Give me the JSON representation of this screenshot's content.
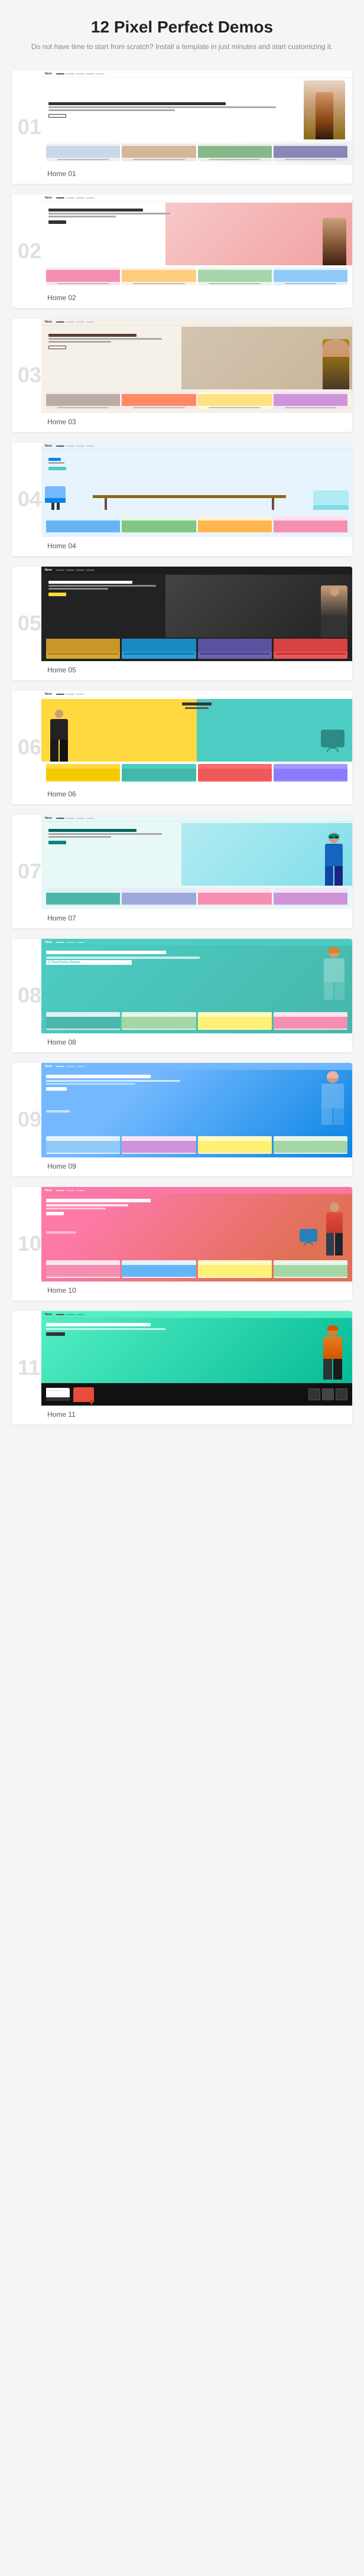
{
  "page": {
    "title": "12 Pixel Perfect Demos",
    "subtitle": "Do not have time to start from scratch? Install a template\nin just minutes and start customizing it."
  },
  "demos": [
    {
      "id": "01",
      "label": "Home 01",
      "theme": "white",
      "accent": "#333333"
    },
    {
      "id": "02",
      "label": "Home 02",
      "theme": "pink",
      "accent": "#f8c8c8"
    },
    {
      "id": "03",
      "label": "Home 03",
      "theme": "beige",
      "accent": "#f5f0e8"
    },
    {
      "id": "04",
      "label": "Home 04",
      "theme": "furniture",
      "accent": "#74b9ff"
    },
    {
      "id": "05",
      "label": "Home 05",
      "theme": "dark",
      "accent": "#333333"
    },
    {
      "id": "06",
      "label": "Home 06",
      "theme": "yellow-teal",
      "accent": "#ffd93d"
    },
    {
      "id": "07",
      "label": "Home 07",
      "theme": "teal-light",
      "accent": "#4ecdc4"
    },
    {
      "id": "08",
      "label": "Home 08",
      "theme": "teal",
      "accent": "#4ecdc4"
    },
    {
      "id": "09",
      "label": "Home 09",
      "theme": "blue",
      "accent": "#74b9ff"
    },
    {
      "id": "10",
      "label": "Home 10",
      "theme": "pink-coral",
      "accent": "#fd79a8"
    },
    {
      "id": "11",
      "label": "Home 11",
      "theme": "mint",
      "accent": "#55efc4"
    }
  ],
  "hero_texts": {
    "h01": {
      "title": "Summer Clothing Holiday",
      "sub": "Shop the latest trends",
      "btn": "Shop Now"
    },
    "h02": {
      "title": "Summer Clothing Holiday",
      "sub": "New arrivals every week",
      "btn": "Shop Now"
    },
    "h03": {
      "title": "Summer Clothing Holiday",
      "sub": "Discover your style",
      "btn": "Shop Now"
    },
    "h04": {
      "title": "Summer Clean",
      "sub": "Modern furniture collection",
      "btn": "Shop Now"
    },
    "h05": {
      "title": "Summer Clothing Holiday",
      "sub": "Trendy items await",
      "btn": "Shop Now"
    },
    "h06": {
      "title": "Summer Clothing Holiday",
      "sub": "Bold styles bold colors",
      "btn": "Shop Now"
    },
    "h07": {
      "title": "Summer Clothing Holiday",
      "sub": "Style meets comfort",
      "btn": "Shop Now"
    },
    "h08": {
      "title": "Welcome to Belle Masion",
      "sub": "17 Pixel Perfect Demos",
      "btn": "Discover"
    },
    "h09": {
      "title": "Summer Clothing Holiday",
      "sub": "Find Boutique",
      "btn": "Shop Now"
    },
    "h10": {
      "title": "Pink Cute Style",
      "sub": "Glitter / Page",
      "btn": "Shop Now"
    },
    "h11": {
      "title": "Summer Style",
      "sub": "Fresh new collection",
      "btn": "Shop Now"
    }
  }
}
